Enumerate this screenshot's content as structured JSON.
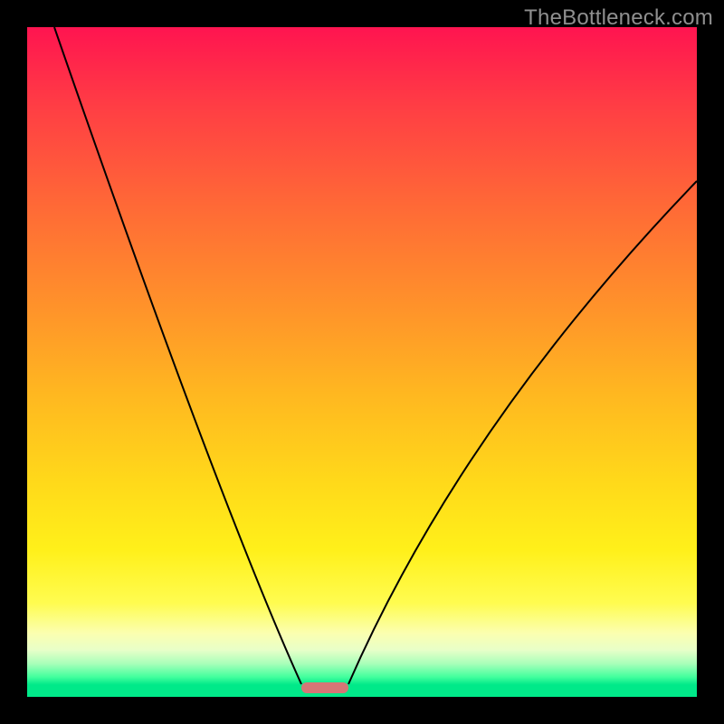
{
  "watermark": {
    "text": "TheBottleneck.com"
  },
  "chart_data": {
    "type": "line",
    "title": "",
    "xlabel": "",
    "ylabel": "",
    "xlim": [
      0,
      100
    ],
    "ylim": [
      0,
      100
    ],
    "grid": false,
    "legend": false,
    "background_gradient": {
      "direction": "vertical",
      "stops": [
        {
          "pos": 0,
          "color": "#ff1450"
        },
        {
          "pos": 55,
          "color": "#ffb820"
        },
        {
          "pos": 86,
          "color": "#fffc50"
        },
        {
          "pos": 97,
          "color": "#44ff9e"
        },
        {
          "pos": 100,
          "color": "#00e989"
        }
      ]
    },
    "optimal_marker": {
      "x_start": 41,
      "x_end": 48,
      "y": 1
    },
    "series": [
      {
        "name": "bottleneck-curve",
        "x": [
          0,
          5,
          10,
          15,
          20,
          25,
          30,
          35,
          40,
          41,
          44.5,
          48,
          50,
          55,
          60,
          65,
          70,
          75,
          80,
          85,
          90,
          95,
          100
        ],
        "values": [
          100,
          91,
          82,
          73,
          63,
          53,
          43,
          32,
          12,
          3,
          1,
          3,
          12,
          25,
          36,
          45,
          52,
          58,
          63,
          67,
          71,
          74,
          77
        ]
      }
    ]
  }
}
